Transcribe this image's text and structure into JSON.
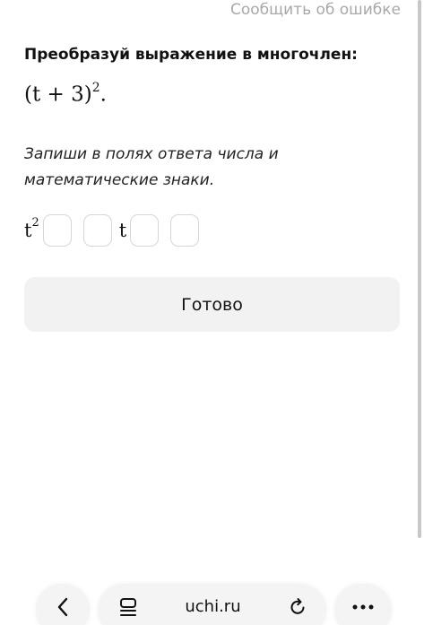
{
  "header": {
    "report_error_link": "Сообщить об ошибке"
  },
  "task": {
    "title": "Преобразуй выражение в многочлен:",
    "expression_base": "(t + 3)",
    "expression_exponent": "2",
    "expression_end": ".",
    "instruction": "Запиши в полях ответа числа и математические знаки."
  },
  "answer": {
    "term1_base": "t",
    "term1_exponent": "2",
    "term2_variable": "t",
    "box1_value": "",
    "box2_value": "",
    "box3_value": "",
    "box4_value": ""
  },
  "actions": {
    "done_label": "Готово"
  },
  "browser": {
    "url": "uchi.ru",
    "icons": [
      "chevron-left-icon",
      "reader-mode-icon",
      "reload-icon",
      "more-dots-icon"
    ]
  }
}
